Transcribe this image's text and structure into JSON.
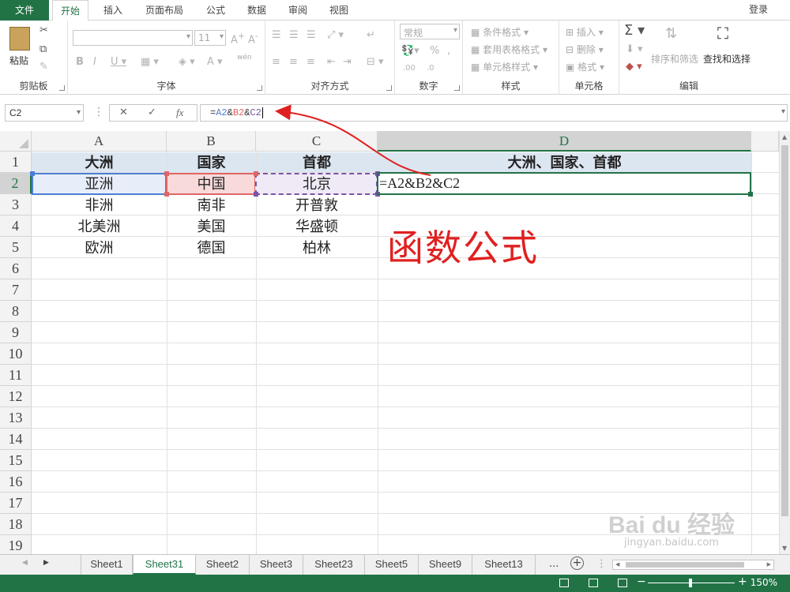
{
  "ribbon_tabs": [
    "文件",
    "开始",
    "插入",
    "页面布局",
    "公式",
    "数据",
    "审阅",
    "视图"
  ],
  "login": "登录",
  "ribbon": {
    "paste": "粘贴",
    "clipboard": "剪贴板",
    "font_size": "11",
    "font_group": "字体",
    "phonetic": "wén",
    "align_group": "对齐方式",
    "number_format": "常规",
    "number_group": "数字",
    "cond_format": "条件格式",
    "table_format": "套用表格格式",
    "cell_style": "单元格样式",
    "styles_group": "样式",
    "insert": "插入",
    "delete": "删除",
    "format": "格式",
    "cells_group": "单元格",
    "sort_filter": "排序和筛选",
    "find_select": "查找和选择",
    "edit_group": "编辑"
  },
  "formula_bar": {
    "name_box": "C2",
    "formula_prefix": "=",
    "ref_a": "A2",
    "amp1": "&",
    "ref_b": "B2",
    "amp2": "&",
    "ref_c": "C2",
    "colors": {
      "ref_a": "#4a7fd4",
      "ref_b": "#e06666",
      "ref_c": "#7a54a8"
    }
  },
  "columns": [
    "A",
    "B",
    "C",
    "D"
  ],
  "rows": [
    "1",
    "2",
    "3",
    "4",
    "5",
    "6",
    "7",
    "8",
    "9",
    "10",
    "11",
    "12",
    "13",
    "14",
    "15",
    "16",
    "17",
    "18",
    "19"
  ],
  "cells": {
    "a1": "大洲",
    "b1": "国家",
    "c1": "首都",
    "d1": "大洲、国家、首都",
    "a2": "亚洲",
    "b2": "中国",
    "c2": "北京",
    "d2": "=A2&B2&C2",
    "a3": "非洲",
    "b3": "南非",
    "c3": "开普敦",
    "a4": "北美洲",
    "b4": "美国",
    "c4": "华盛顿",
    "a5": "欧洲",
    "b5": "德国",
    "c5": "柏林"
  },
  "annotation": "函数公式",
  "sheets": [
    "Sheet1",
    "Sheet31",
    "Sheet2",
    "Sheet3",
    "Sheet23",
    "Sheet5",
    "Sheet9",
    "Sheet13"
  ],
  "active_sheet": "Sheet31",
  "sheet_more": "...",
  "status": {
    "ready": "",
    "zoom": "150%"
  },
  "accent_color": "#217346",
  "watermark": "Bai du 经验",
  "watermark_sub": "jingyan.baidu.com"
}
